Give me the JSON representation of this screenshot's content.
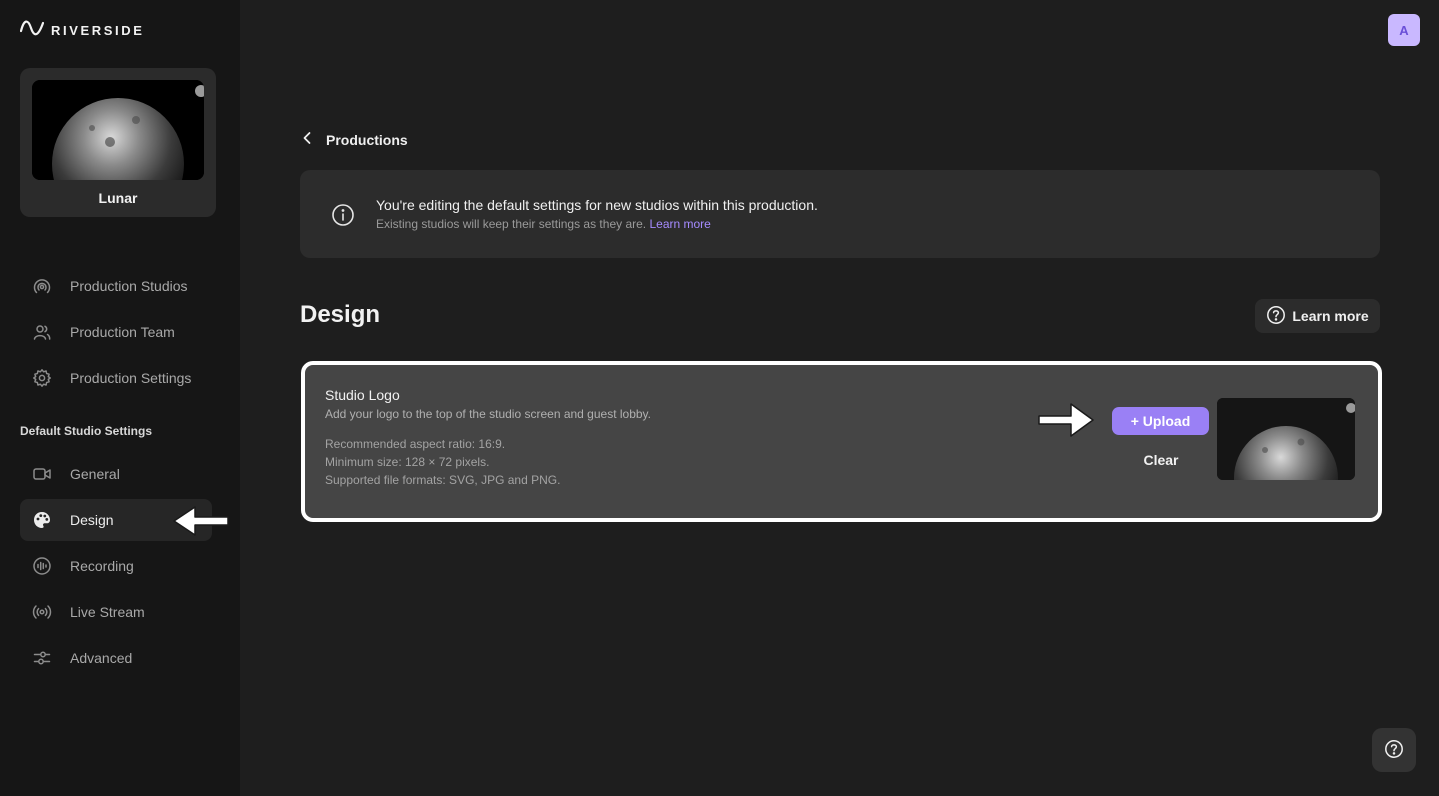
{
  "brand": {
    "name": "RIVERSIDE",
    "icon": "wave-logo-icon"
  },
  "production": {
    "name": "Lunar",
    "thumbnail": "planet-image"
  },
  "sidebar": {
    "items": [
      {
        "label": "Production Studios",
        "icon": "broadcast-icon"
      },
      {
        "label": "Production Team",
        "icon": "team-icon"
      },
      {
        "label": "Production Settings",
        "icon": "gear-icon"
      }
    ],
    "section_label": "Default Studio Settings",
    "studio_items": [
      {
        "label": "General",
        "icon": "camera-icon"
      },
      {
        "label": "Design",
        "icon": "palette-icon",
        "active": true
      },
      {
        "label": "Recording",
        "icon": "waveform-icon"
      },
      {
        "label": "Live Stream",
        "icon": "live-stream-icon"
      },
      {
        "label": "Advanced",
        "icon": "sliders-icon"
      }
    ]
  },
  "user": {
    "initial": "A"
  },
  "breadcrumb": {
    "back_label": "Productions"
  },
  "banner": {
    "title": "You're editing the default settings for new studios within this production.",
    "subtitle": "Existing studios will keep their settings as they are.",
    "link": "Learn more"
  },
  "page": {
    "title": "Design",
    "learn_more": "Learn more"
  },
  "studio_logo": {
    "title": "Studio Logo",
    "description": "Add your logo to the top of the studio screen and guest lobby.",
    "specs": [
      "Recommended aspect ratio: 16:9.",
      "Minimum size: 128 × 72 pixels.",
      "Supported file formats: SVG, JPG and PNG."
    ],
    "upload_label": "+ Upload",
    "clear_label": "Clear"
  },
  "colors": {
    "accent": "#9a80f5",
    "link": "#a58bff",
    "avatar_bg": "#c9b8ff",
    "background": "#1e1e1e",
    "sidebar": "#161616"
  }
}
